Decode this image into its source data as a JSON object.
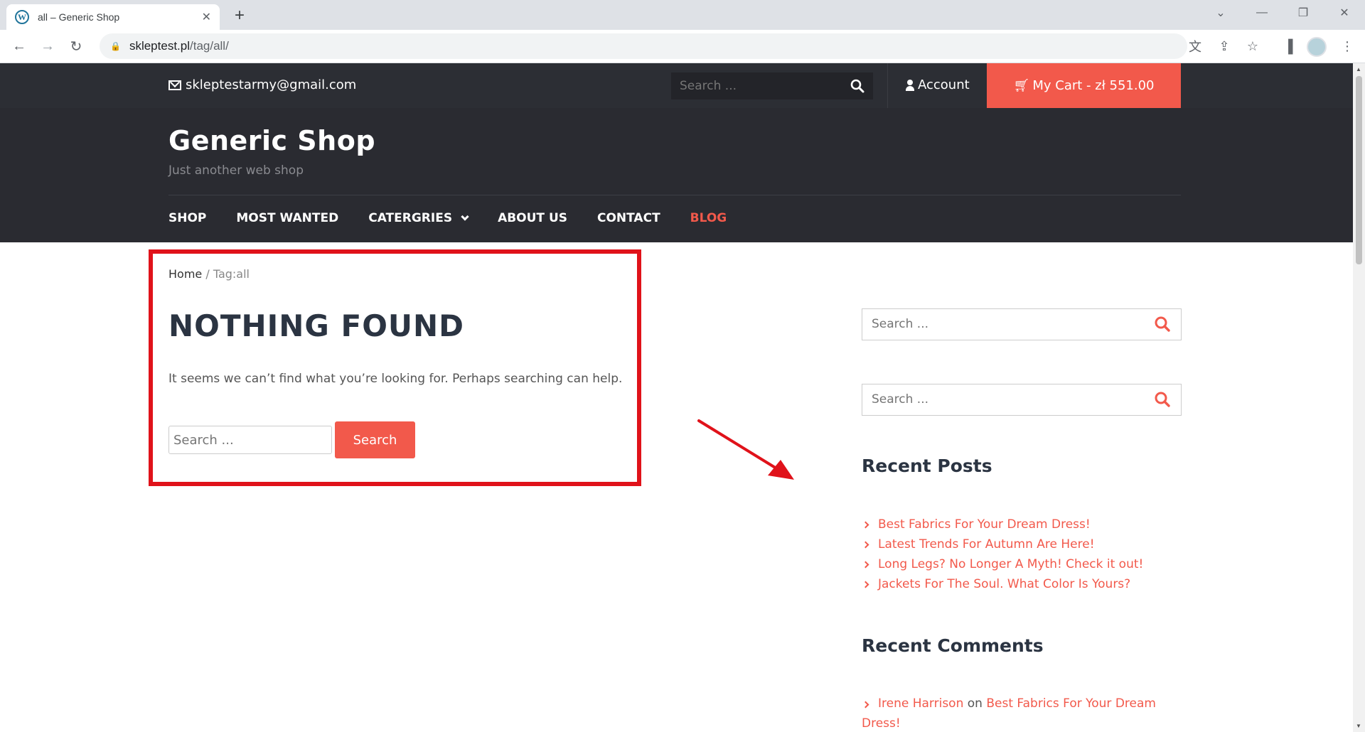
{
  "browser": {
    "tab_title": "all – Generic Shop",
    "url_host": "skleptest.pl",
    "url_path": "/tag/all/"
  },
  "topbar": {
    "email": "skleptestarmy@gmail.com",
    "search_placeholder": "Search ...",
    "account_label": "Account",
    "cart_label": "My Cart - zł 551.00"
  },
  "header": {
    "site_title": "Generic Shop",
    "tagline": "Just another web shop",
    "menu": [
      "SHOP",
      "MOST WANTED",
      "CATERGRIES",
      "ABOUT US",
      "CONTACT",
      "BLOG"
    ]
  },
  "main": {
    "breadcrumb_home": "Home",
    "breadcrumb_sep": "/",
    "breadcrumb_current": "Tag:all",
    "title": "NOTHING FOUND",
    "message": "It seems we can’t find what you’re looking for. Perhaps searching can help.",
    "search_placeholder": "Search ...",
    "search_button": "Search"
  },
  "sidebar": {
    "search_placeholder": "Search ...",
    "recent_posts_title": "Recent Posts",
    "recent_posts": [
      "Best Fabrics For Your Dream Dress!",
      "Latest Trends For Autumn Are Here!",
      "Long Legs? No Longer A Myth! Check it out!",
      "Jackets For The Soul. What Color Is Yours?"
    ],
    "recent_comments_title": "Recent Comments",
    "comment_author": "Irene Harrison",
    "comment_on": "on",
    "comment_post": "Best Fabrics For Your Dream Dress!"
  },
  "colors": {
    "accent": "#f2594b",
    "dark": "#2a2b31",
    "highlight": "#e0121a"
  }
}
